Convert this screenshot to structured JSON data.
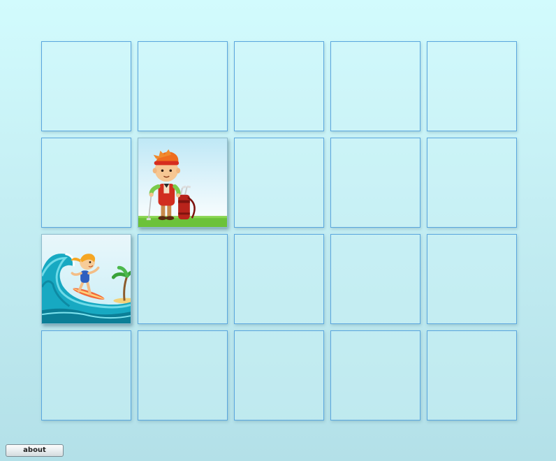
{
  "about_button": {
    "label": "about"
  },
  "board": {
    "rows": 4,
    "columns": 5,
    "cards": [
      {
        "row": 1,
        "col": 1,
        "state": "hidden"
      },
      {
        "row": 1,
        "col": 2,
        "state": "hidden"
      },
      {
        "row": 1,
        "col": 3,
        "state": "hidden"
      },
      {
        "row": 1,
        "col": 4,
        "state": "hidden"
      },
      {
        "row": 1,
        "col": 5,
        "state": "hidden"
      },
      {
        "row": 2,
        "col": 1,
        "state": "hidden"
      },
      {
        "row": 2,
        "col": 2,
        "state": "revealed",
        "picture": "golfer-boy"
      },
      {
        "row": 2,
        "col": 3,
        "state": "hidden"
      },
      {
        "row": 2,
        "col": 4,
        "state": "hidden"
      },
      {
        "row": 2,
        "col": 5,
        "state": "hidden"
      },
      {
        "row": 3,
        "col": 1,
        "state": "revealed",
        "picture": "surfer-girl"
      },
      {
        "row": 3,
        "col": 2,
        "state": "hidden"
      },
      {
        "row": 3,
        "col": 3,
        "state": "hidden"
      },
      {
        "row": 3,
        "col": 4,
        "state": "hidden"
      },
      {
        "row": 3,
        "col": 5,
        "state": "hidden"
      },
      {
        "row": 4,
        "col": 1,
        "state": "hidden"
      },
      {
        "row": 4,
        "col": 2,
        "state": "hidden"
      },
      {
        "row": 4,
        "col": 3,
        "state": "hidden"
      },
      {
        "row": 4,
        "col": 4,
        "state": "hidden"
      },
      {
        "row": 4,
        "col": 5,
        "state": "hidden"
      }
    ]
  },
  "colors": {
    "card_border": "#5aa6de",
    "background_top": "#d2fbfd",
    "background_bottom": "#b3e0e8"
  }
}
